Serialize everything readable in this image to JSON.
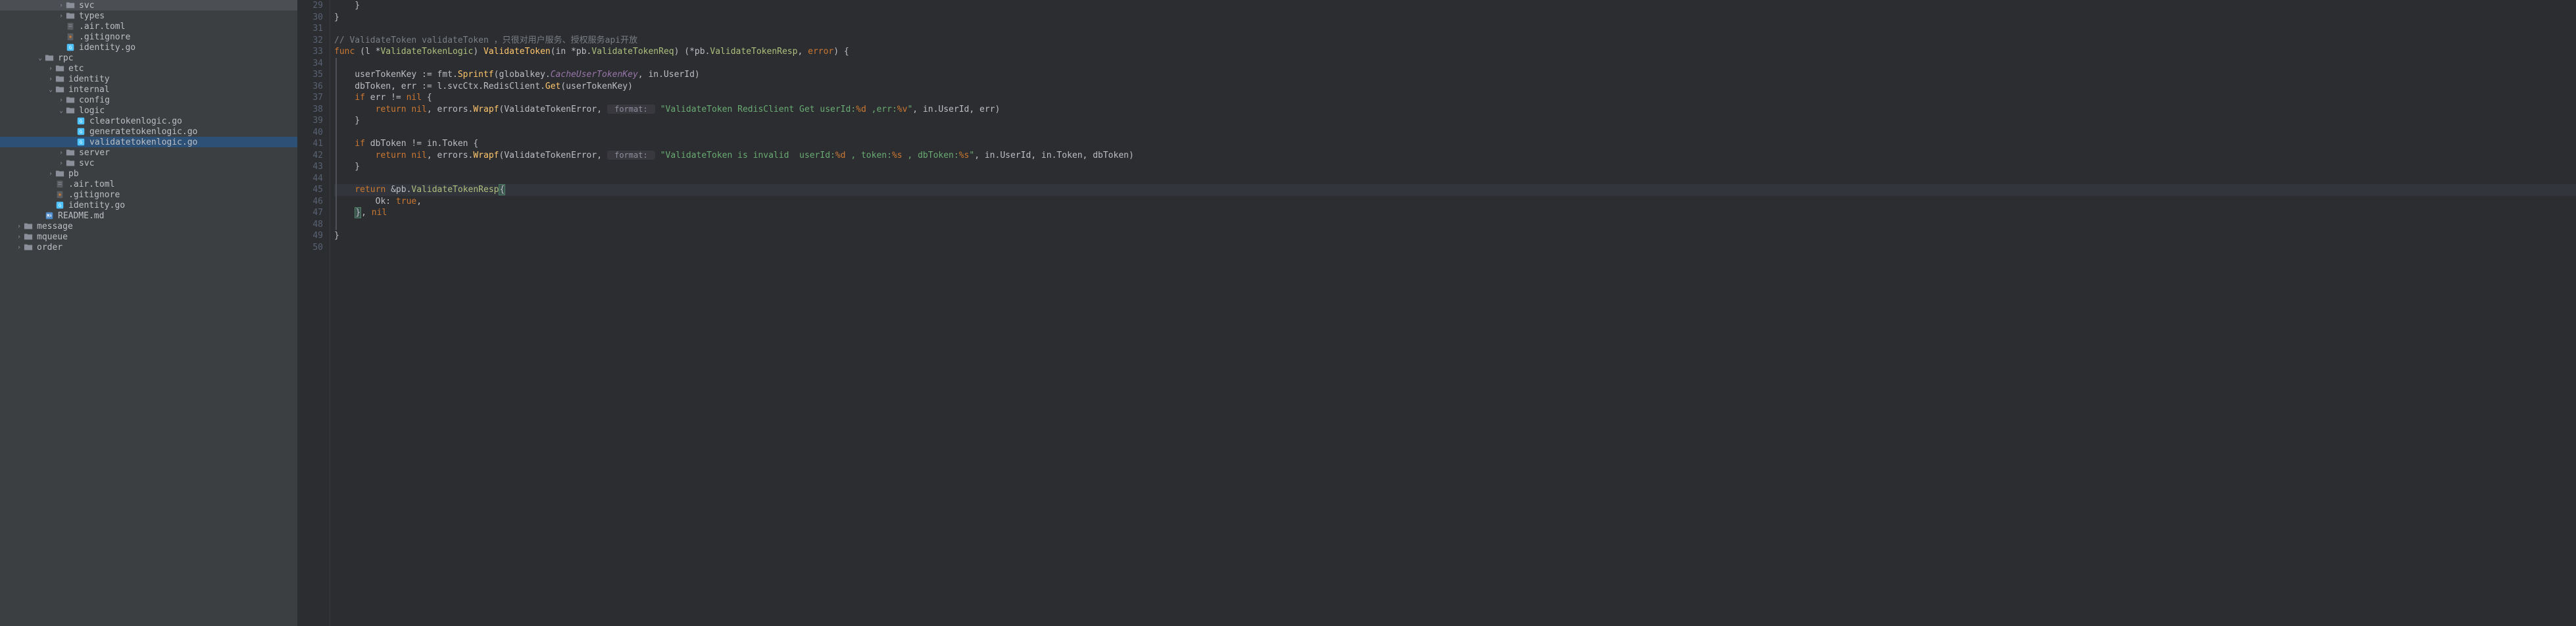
{
  "tree": {
    "items": [
      {
        "indent": 5,
        "chevron": ">",
        "icon": "folder",
        "label": "svc"
      },
      {
        "indent": 5,
        "chevron": ">",
        "icon": "folder",
        "label": "types"
      },
      {
        "indent": 5,
        "chevron": "",
        "icon": "toml",
        "label": ".air.toml"
      },
      {
        "indent": 5,
        "chevron": "",
        "icon": "gitignore",
        "label": ".gitignore"
      },
      {
        "indent": 5,
        "chevron": "",
        "icon": "go",
        "label": "identity.go"
      },
      {
        "indent": 3,
        "chevron": "v",
        "icon": "folder",
        "label": "rpc"
      },
      {
        "indent": 4,
        "chevron": ">",
        "icon": "folder",
        "label": "etc"
      },
      {
        "indent": 4,
        "chevron": ">",
        "icon": "folder",
        "label": "identity"
      },
      {
        "indent": 4,
        "chevron": "v",
        "icon": "folder",
        "label": "internal"
      },
      {
        "indent": 5,
        "chevron": ">",
        "icon": "folder",
        "label": "config"
      },
      {
        "indent": 5,
        "chevron": "v",
        "icon": "folder",
        "label": "logic"
      },
      {
        "indent": 6,
        "chevron": "",
        "icon": "go",
        "label": "cleartokenlogic.go"
      },
      {
        "indent": 6,
        "chevron": "",
        "icon": "go",
        "label": "generatetokenlogic.go"
      },
      {
        "indent": 6,
        "chevron": "",
        "icon": "go",
        "label": "validatetokenlogic.go",
        "highlighted": true
      },
      {
        "indent": 5,
        "chevron": ">",
        "icon": "folder",
        "label": "server"
      },
      {
        "indent": 5,
        "chevron": ">",
        "icon": "folder",
        "label": "svc"
      },
      {
        "indent": 4,
        "chevron": ">",
        "icon": "folder",
        "label": "pb"
      },
      {
        "indent": 4,
        "chevron": "",
        "icon": "toml",
        "label": ".air.toml"
      },
      {
        "indent": 4,
        "chevron": "",
        "icon": "gitignore",
        "label": ".gitignore"
      },
      {
        "indent": 4,
        "chevron": "",
        "icon": "go",
        "label": "identity.go"
      },
      {
        "indent": 3,
        "chevron": "",
        "icon": "md",
        "label": "README.md"
      },
      {
        "indent": 1,
        "chevron": ">",
        "icon": "folder",
        "label": "message"
      },
      {
        "indent": 1,
        "chevron": ">",
        "icon": "folder",
        "label": "mqueue"
      },
      {
        "indent": 1,
        "chevron": ">",
        "icon": "folder",
        "label": "order"
      }
    ]
  },
  "gutter": {
    "start": 29,
    "end": 50
  },
  "code": {
    "lines": [
      {
        "n": 29,
        "segs": [
          {
            "t": "    }",
            "c": "ident"
          }
        ]
      },
      {
        "n": 30,
        "segs": [
          {
            "t": "}",
            "c": "ident"
          }
        ]
      },
      {
        "n": 31,
        "segs": []
      },
      {
        "n": 32,
        "segs": [
          {
            "t": "// ValidateToken ",
            "c": "comment"
          },
          {
            "t": "validateToken ",
            "c": "hint"
          },
          {
            "t": "，只很对用户服务、授权服务api开放",
            "c": "comment"
          }
        ]
      },
      {
        "n": 33,
        "segs": [
          {
            "t": "func ",
            "c": "kw"
          },
          {
            "t": "(l *",
            "c": "ident"
          },
          {
            "t": "ValidateTokenLogic",
            "c": "type"
          },
          {
            "t": ") ",
            "c": "ident"
          },
          {
            "t": "ValidateToken",
            "c": "fn"
          },
          {
            "t": "(in *",
            "c": "ident"
          },
          {
            "t": "pb",
            "c": "ident"
          },
          {
            "t": ".",
            "c": "ident"
          },
          {
            "t": "ValidateTokenReq",
            "c": "type"
          },
          {
            "t": ") (*",
            "c": "ident"
          },
          {
            "t": "pb",
            "c": "ident"
          },
          {
            "t": ".",
            "c": "ident"
          },
          {
            "t": "ValidateTokenResp",
            "c": "type"
          },
          {
            "t": ", ",
            "c": "ident"
          },
          {
            "t": "error",
            "c": "kw"
          },
          {
            "t": ") {",
            "c": "ident"
          }
        ]
      },
      {
        "n": 34,
        "segs": []
      },
      {
        "n": 35,
        "segs": [
          {
            "t": "    userTokenKey := fmt.",
            "c": "ident"
          },
          {
            "t": "Sprintf",
            "c": "fn"
          },
          {
            "t": "(globalkey.",
            "c": "ident"
          },
          {
            "t": "CacheUserTokenKey",
            "c": "prop",
            "italic": true
          },
          {
            "t": ", in.UserId)",
            "c": "ident"
          }
        ]
      },
      {
        "n": 36,
        "segs": [
          {
            "t": "    dbToken, err := l.svcCtx.RedisClient.",
            "c": "ident"
          },
          {
            "t": "Get",
            "c": "fn"
          },
          {
            "t": "(userTokenKey)",
            "c": "ident"
          }
        ]
      },
      {
        "n": 37,
        "segs": [
          {
            "t": "    ",
            "c": "ident"
          },
          {
            "t": "if ",
            "c": "kw"
          },
          {
            "t": "err != ",
            "c": "ident"
          },
          {
            "t": "nil ",
            "c": "kw"
          },
          {
            "t": "{",
            "c": "ident"
          }
        ]
      },
      {
        "n": 38,
        "segs": [
          {
            "t": "        ",
            "c": "ident"
          },
          {
            "t": "return ",
            "c": "kw"
          },
          {
            "t": "nil",
            "c": "kw"
          },
          {
            "t": ", errors.",
            "c": "ident"
          },
          {
            "t": "Wrapf",
            "c": "fn"
          },
          {
            "t": "(ValidateTokenError, ",
            "c": "ident"
          },
          {
            "t": " format: ",
            "c": "hint-box"
          },
          {
            "t": " ",
            "c": "ident"
          },
          {
            "t": "\"ValidateToken RedisClient Get userId:",
            "c": "str"
          },
          {
            "t": "%d",
            "c": "fmt-verb"
          },
          {
            "t": " ,err:",
            "c": "str"
          },
          {
            "t": "%v",
            "c": "fmt-verb"
          },
          {
            "t": "\"",
            "c": "str"
          },
          {
            "t": ", in.UserId, err)",
            "c": "ident"
          }
        ]
      },
      {
        "n": 39,
        "segs": [
          {
            "t": "    }",
            "c": "ident"
          }
        ]
      },
      {
        "n": 40,
        "segs": []
      },
      {
        "n": 41,
        "segs": [
          {
            "t": "    ",
            "c": "ident"
          },
          {
            "t": "if ",
            "c": "kw"
          },
          {
            "t": "dbToken != in.Token {",
            "c": "ident"
          }
        ]
      },
      {
        "n": 42,
        "segs": [
          {
            "t": "        ",
            "c": "ident"
          },
          {
            "t": "return ",
            "c": "kw"
          },
          {
            "t": "nil",
            "c": "kw"
          },
          {
            "t": ", errors.",
            "c": "ident"
          },
          {
            "t": "Wrapf",
            "c": "fn"
          },
          {
            "t": "(ValidateTokenError, ",
            "c": "ident"
          },
          {
            "t": " format: ",
            "c": "hint-box"
          },
          {
            "t": " ",
            "c": "ident"
          },
          {
            "t": "\"ValidateToken is invalid  userId:",
            "c": "str"
          },
          {
            "t": "%d",
            "c": "fmt-verb"
          },
          {
            "t": " , token:",
            "c": "str"
          },
          {
            "t": "%s",
            "c": "fmt-verb"
          },
          {
            "t": " , dbToken:",
            "c": "str"
          },
          {
            "t": "%s",
            "c": "fmt-verb"
          },
          {
            "t": "\"",
            "c": "str"
          },
          {
            "t": ", in.UserId, in.Token, dbToken)",
            "c": "ident"
          }
        ]
      },
      {
        "n": 43,
        "segs": [
          {
            "t": "    }",
            "c": "ident"
          }
        ]
      },
      {
        "n": 44,
        "segs": []
      },
      {
        "n": 45,
        "current": true,
        "bulb": true,
        "segs": [
          {
            "t": "    ",
            "c": "ident"
          },
          {
            "t": "return ",
            "c": "kw"
          },
          {
            "t": "&pb.",
            "c": "ident"
          },
          {
            "t": "ValidateTokenResp",
            "c": "type"
          },
          {
            "t": "{",
            "c": "paren-match"
          }
        ]
      },
      {
        "n": 46,
        "segs": [
          {
            "t": "        Ok: ",
            "c": "ident"
          },
          {
            "t": "true",
            "c": "kw"
          },
          {
            "t": ",",
            "c": "ident"
          }
        ]
      },
      {
        "n": 47,
        "segs": [
          {
            "t": "    ",
            "c": "ident"
          },
          {
            "t": "}",
            "c": "paren-match"
          },
          {
            "t": ", ",
            "c": "ident"
          },
          {
            "t": "nil",
            "c": "kw"
          }
        ]
      },
      {
        "n": 48,
        "segs": []
      },
      {
        "n": 49,
        "segs": [
          {
            "t": "}",
            "c": "ident"
          }
        ]
      },
      {
        "n": 50,
        "segs": []
      }
    ]
  }
}
